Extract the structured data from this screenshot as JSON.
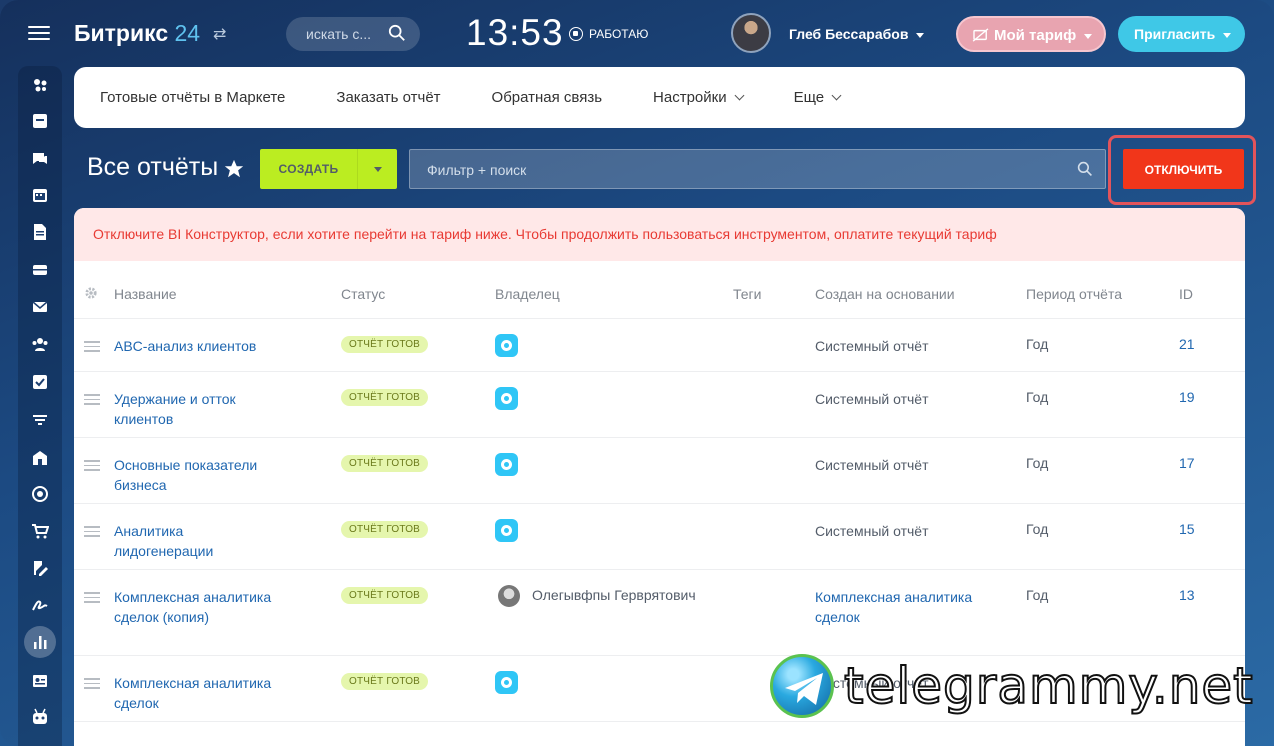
{
  "header": {
    "logo_name": "Битрикс",
    "logo_num": "24",
    "search_placeholder": "искать с...",
    "clock": "13:53",
    "work_status": "РАБОТАЮ",
    "user_name": "Глеб Бессарабов",
    "tariff_label": "Мой тариф",
    "invite_label": "Пригласить"
  },
  "submenu": {
    "items": [
      {
        "label": "Готовые отчёты в Маркете"
      },
      {
        "label": "Заказать отчёт"
      },
      {
        "label": "Обратная связь"
      },
      {
        "label": "Настройки"
      },
      {
        "label": "Еще"
      }
    ]
  },
  "page": {
    "title": "Все отчёты",
    "create_label": "СОЗДАТЬ",
    "filter_placeholder": "Фильтр + поиск",
    "disable_label": "ОТКЛЮЧИТЬ",
    "alert": "Отключите BI Конструктор, если хотите перейти на тариф ниже. Чтобы продолжить пользоваться инструментом, оплатите текущий тариф"
  },
  "table": {
    "columns": {
      "name": "Название",
      "status": "Статус",
      "owner": "Владелец",
      "tags": "Теги",
      "based_on": "Создан на основании",
      "period": "Период отчёта",
      "id": "ID"
    },
    "rows": [
      {
        "name": "ABC-анализ клиентов",
        "status": "ОТЧЁТ ГОТОВ",
        "owner": "",
        "based_on": "Системный отчёт",
        "period": "Год",
        "id": "21"
      },
      {
        "name": "Удержание и отток клиентов",
        "status": "ОТЧЁТ ГОТОВ",
        "owner": "",
        "based_on": "Системный отчёт",
        "period": "Год",
        "id": "19"
      },
      {
        "name": "Основные показатели бизнеса",
        "status": "ОТЧЁТ ГОТОВ",
        "owner": "",
        "based_on": "Системный отчёт",
        "period": "Год",
        "id": "17"
      },
      {
        "name": "Аналитика лидогенерации",
        "status": "ОТЧЁТ ГОТОВ",
        "owner": "",
        "based_on": "Системный отчёт",
        "period": "Год",
        "id": "15"
      },
      {
        "name": "Комплексная аналитика сделок (копия)",
        "status": "ОТЧЁТ ГОТОВ",
        "owner": "Олегывфпы Герврятович",
        "based_on": "Комплексная аналитика сделок",
        "period": "Год",
        "id": "13"
      },
      {
        "name": "Комплексная аналитика сделок",
        "status": "ОТЧЁТ ГОТОВ",
        "owner": "",
        "based_on": "Системный отчёт",
        "period": "",
        "id": ""
      }
    ]
  },
  "watermark": "telegrammy.net"
}
